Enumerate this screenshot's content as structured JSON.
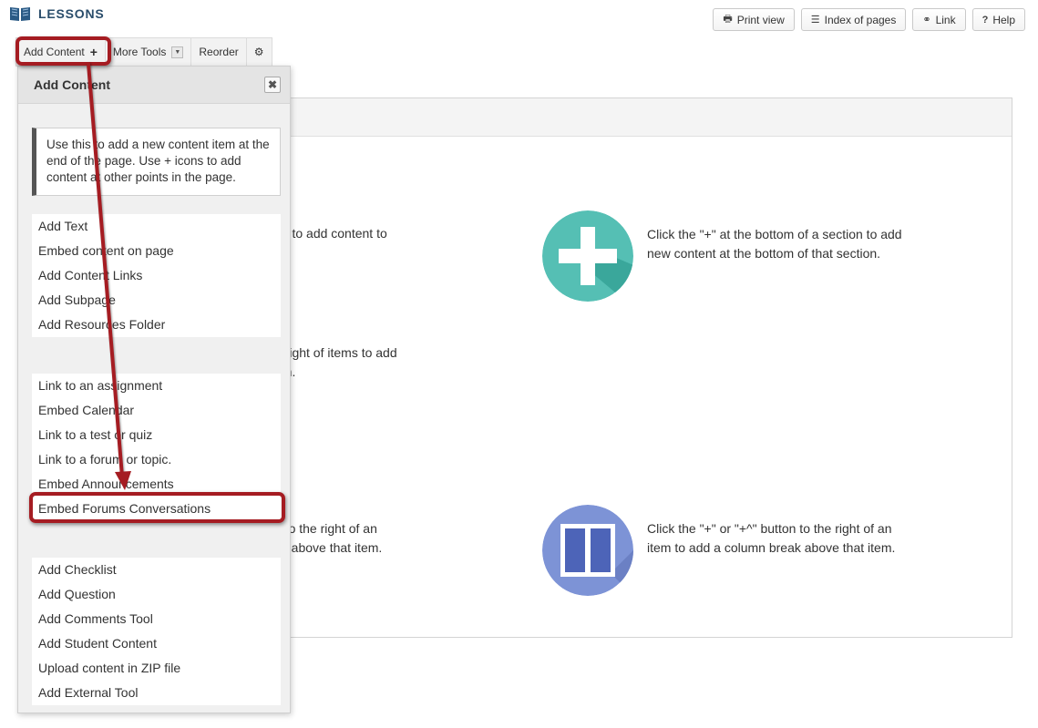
{
  "header": {
    "title": "LESSONS",
    "icon": "book-icon"
  },
  "top_buttons": [
    {
      "label": "Print view",
      "icon": "printer-icon"
    },
    {
      "label": "Index of pages",
      "icon": "list-icon"
    },
    {
      "label": "Link",
      "icon": "link-icon"
    },
    {
      "label": "Help",
      "icon": "question-icon"
    }
  ],
  "toolbar": {
    "add_content": "Add Content",
    "add_content_icon": "+",
    "more_tools": "More Tools",
    "reorder": "Reorder"
  },
  "background_text": {
    "t1": "ab to add content to",
    "t2a": "e right of items to add",
    "t2b": "em.",
    "t3a": "n to the right of an",
    "t3b": "ak above that item.",
    "plus_desc": "Click the \"+\" at the bottom of a section to add new content at the bottom of that section.",
    "column_desc": "Click the \"+\" or \"+^\" button to the right of an item to add a column break above that item."
  },
  "colors": {
    "highlight": "#a51c22",
    "plus_circle": "#55bfb4",
    "column_circle": "#7d93d6"
  },
  "panel": {
    "title": "Add Content",
    "close": "✖",
    "info": "Use this to add a new content item at the end of the page. Use + icons to add content at other points in the page.",
    "group1": [
      "Add Text",
      "Embed content on page",
      "Add Content Links",
      "Add Subpage",
      "Add Resources Folder"
    ],
    "group2": [
      "Link to an assignment",
      "Embed Calendar",
      "Link to a test or quiz",
      "Link to a forum or topic.",
      "Embed Announcements",
      "Embed Forums Conversations"
    ],
    "group3": [
      "Add Checklist",
      "Add Question",
      "Add Comments Tool",
      "Add Student Content",
      "Upload content in ZIP file",
      "Add External Tool"
    ]
  }
}
